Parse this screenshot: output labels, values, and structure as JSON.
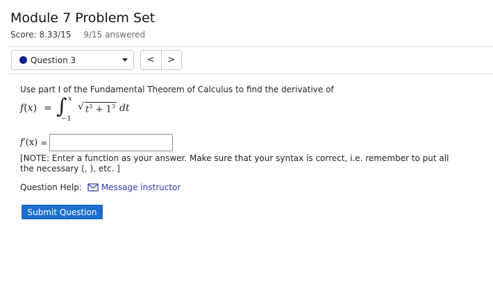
{
  "page": {
    "title": "Module 7 Problem Set",
    "score_label": "Score: 8.33/15",
    "answered_label": "9/15 answered"
  },
  "question_selector": {
    "selected": "Question 3",
    "status_color": "#0b1f8f"
  },
  "nav": {
    "prev_label": "<",
    "next_label": ">"
  },
  "question": {
    "prompt": "Use part I of the Fundamental Theorem of Calculus to find the derivative of",
    "formula": {
      "function_name": "f",
      "variable": "x",
      "equals": "=",
      "integral_symbol": "∫",
      "upper_limit": "x",
      "lower_limit": "−1",
      "radical_symbol": "√",
      "radicand_base": "t",
      "radicand_exp1": "3",
      "radicand_plus": " + 1",
      "radicand_exp2": "3",
      "differential": "dt"
    },
    "answer_label_fn": "f",
    "answer_label_prime": "′",
    "answer_label_arg": "(x)",
    "answer_equals": "=",
    "answer_value": "",
    "note": "[NOTE: Enter a function as your answer. Make sure that your syntax is correct, i.e. remember to put all the necessary (, ), etc. ]"
  },
  "help": {
    "label": "Question Help:",
    "link_label": "Message instructor",
    "icon": "mail-icon"
  },
  "submit": {
    "label": "Submit Question",
    "color": "#1c6fd1"
  }
}
